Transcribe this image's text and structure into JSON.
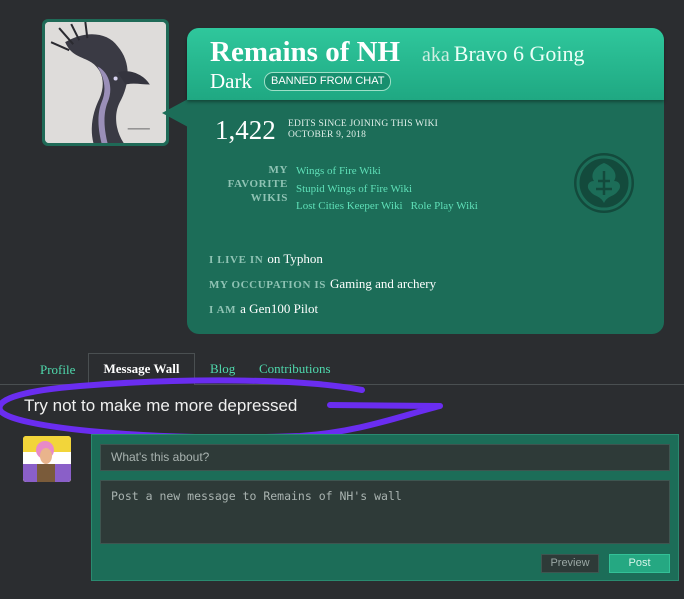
{
  "profile": {
    "name": "Remains of NH",
    "aka_label": "aka",
    "aka_name": "Bravo 6 Going",
    "aka_name_cont": "Dark",
    "badge": "BANNED FROM CHAT",
    "edit_count": "1,422",
    "edits_label": "EDITS SINCE JOINING THIS WIKI",
    "join_date": "OCTOBER 9, 2018",
    "favorite_wikis_label_1": "MY",
    "favorite_wikis_label_2": "FAVORITE",
    "favorite_wikis_label_3": "WIKIS",
    "favorite_wikis": [
      "Wings of Fire Wiki",
      "Stupid Wings of Fire Wiki",
      "Lost Cities Keeper Wiki",
      "Role Play Wiki"
    ],
    "live_label": "I LIVE IN",
    "live_value": "on Typhon",
    "occupation_label": "MY OCCUPATION IS",
    "occupation_value": "Gaming and archery",
    "iam_label": "I AM",
    "iam_value": "a Gen100 Pilot"
  },
  "tabs": {
    "profile": "Profile",
    "message_wall": "Message Wall",
    "blog": "Blog",
    "contributions": "Contributions"
  },
  "wall": {
    "message": "Try not to make me more depressed"
  },
  "composer": {
    "title_placeholder": "What's this about?",
    "body_placeholder": "Post a new message to Remains of NH's wall",
    "preview_label": "Preview",
    "post_label": "Post"
  },
  "colors": {
    "accent": "#1fa882",
    "card": "#1c6d58",
    "link": "#5fe0b8",
    "scribble": "#6a2df0"
  },
  "icons": {
    "emblem": "dragon-emblem-icon"
  }
}
